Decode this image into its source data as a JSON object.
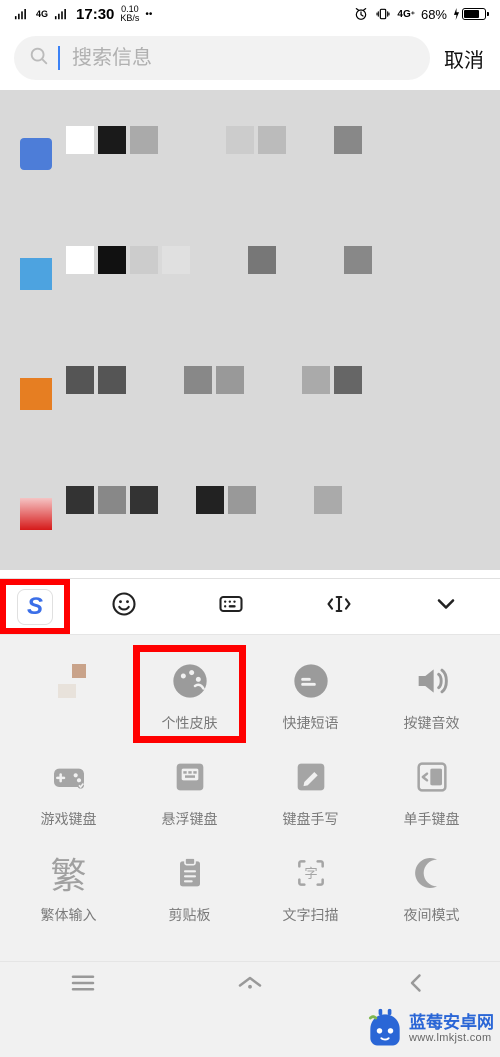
{
  "status": {
    "signal": "⁴ᴳ",
    "time": "17:30",
    "speed_top": "0.10",
    "speed_bottom": "KB/s",
    "battery_pct": "68%"
  },
  "search": {
    "placeholder": "搜索信息",
    "cancel": "取消"
  },
  "toolbar": {
    "logo": "S"
  },
  "settings": [
    {
      "label": "",
      "icon": "blank"
    },
    {
      "label": "个性皮肤",
      "icon": "palette",
      "hl": true
    },
    {
      "label": "快捷短语",
      "icon": "quote"
    },
    {
      "label": "按键音效",
      "icon": "sound"
    },
    {
      "label": "游戏键盘",
      "icon": "gamepad"
    },
    {
      "label": "悬浮键盘",
      "icon": "float-kb"
    },
    {
      "label": "键盘手写",
      "icon": "handwrite"
    },
    {
      "label": "单手键盘",
      "icon": "onehand"
    },
    {
      "label": "繁体输入",
      "icon": "fan-char"
    },
    {
      "label": "剪贴板",
      "icon": "clipboard"
    },
    {
      "label": "文字扫描",
      "icon": "scan"
    },
    {
      "label": "夜间模式",
      "icon": "moon"
    }
  ],
  "watermark": {
    "title": "蓝莓安卓网",
    "url": "www.lmkjst.com"
  }
}
